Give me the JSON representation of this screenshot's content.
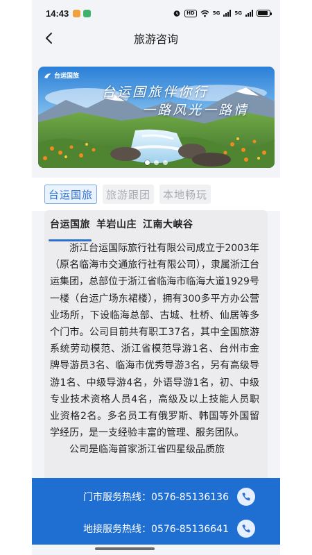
{
  "status_bar": {
    "time": "14:43",
    "network_label": "5G",
    "hd_label": "HD"
  },
  "header": {
    "back_icon": "chevron-left-icon",
    "title": "旅游咨询"
  },
  "banner": {
    "logo_text": "台运国旅",
    "slogan_line1": "台运国旅伴你行",
    "slogan_line2": "一路风光一路情",
    "slide_count": 3,
    "active_slide": 1
  },
  "category_tabs": [
    {
      "label": "台运国旅",
      "active": true
    },
    {
      "label": "旅游跟团",
      "active": false
    },
    {
      "label": "本地畅玩",
      "active": false
    }
  ],
  "sub_tabs": [
    {
      "label": "台运国旅",
      "active": true
    },
    {
      "label": "羊岩山庄",
      "active": false
    },
    {
      "label": "江南大峡谷",
      "active": false
    }
  ],
  "article": {
    "paragraph_1": "浙江台运国际旅行社有限公司成立于2003年（原名临海市交通旅行社有限公司），隶属浙江台运集团，总部位于浙江省临海市临海大道1929号一楼（台运广场东裙楼），拥有300多平方办公营业场所，下设临海总部、古城、杜桥、仙居等多个门市。公司目前共有职工37名，其中全国旅游系统劳动模范、浙江省模范导游1名、台州市金牌导游员3名、临海市优秀导游3名，另有高级导游1名、中级导游4名，外语导游1名，初、中级专业技术资格人员4名，高级及以上技能人员职业资格2名。多名员工有俄罗斯、韩国等外国留学经历，是一支经验丰富的管理、服务团队。",
    "paragraph_2": "公司是临海首家浙江省四星级品质旅"
  },
  "hotlines": [
    {
      "label": "门市服务热线：0576-85136136",
      "icon": "phone-icon"
    },
    {
      "label": "地接服务热线：0576-85136641",
      "icon": "phone-icon"
    }
  ],
  "colors": {
    "accent": "#2b6fd0",
    "hotline_panel": "#1f6fd2"
  }
}
